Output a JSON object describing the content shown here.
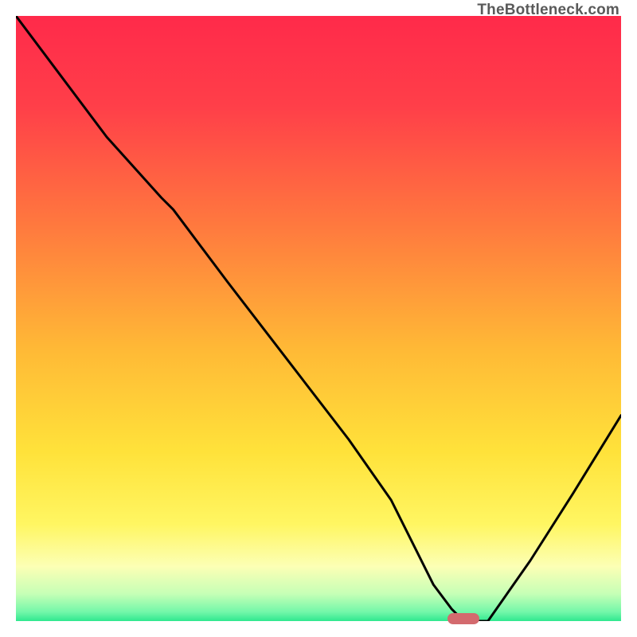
{
  "watermark": "TheBottleneck.com",
  "colors": {
    "gradient_stops": [
      {
        "offset": 0.0,
        "color": "#ff2a4a"
      },
      {
        "offset": 0.15,
        "color": "#ff3f49"
      },
      {
        "offset": 0.35,
        "color": "#ff7a3e"
      },
      {
        "offset": 0.55,
        "color": "#ffb936"
      },
      {
        "offset": 0.72,
        "color": "#ffe23a"
      },
      {
        "offset": 0.84,
        "color": "#fff662"
      },
      {
        "offset": 0.91,
        "color": "#fcffb5"
      },
      {
        "offset": 0.955,
        "color": "#c6ffb6"
      },
      {
        "offset": 0.985,
        "color": "#73f7a9"
      },
      {
        "offset": 1.0,
        "color": "#2fe88f"
      }
    ],
    "curve": "#000000",
    "marker": "#d36a6e",
    "watermark": "#5a5a5a"
  },
  "chart_data": {
    "type": "line",
    "title": "",
    "xlabel": "",
    "ylabel": "",
    "xlim": [
      0,
      100
    ],
    "ylim": [
      0,
      100
    ],
    "grid": false,
    "series": [
      {
        "name": "bottleneck-curve",
        "x": [
          0,
          6,
          15,
          24,
          26,
          35,
          45,
          55,
          62,
          66,
          69,
          72,
          74,
          78,
          85,
          92,
          100
        ],
        "values": [
          100,
          92,
          80,
          70,
          68,
          56,
          43,
          30,
          20,
          12,
          6,
          2,
          0,
          0,
          10,
          21,
          34
        ]
      }
    ],
    "optimal_marker": {
      "x": 74,
      "y": 0
    },
    "annotations": []
  }
}
